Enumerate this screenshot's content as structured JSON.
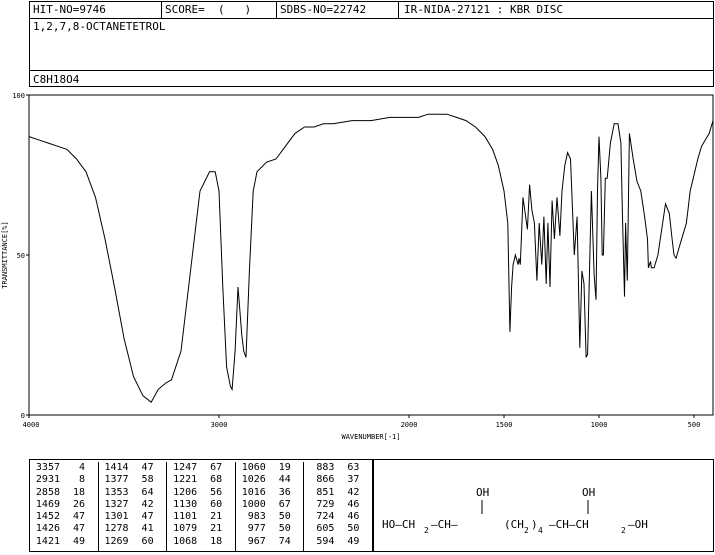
{
  "header": {
    "hit_no": "HIT-NO=9746",
    "score": "SCORE=  (   )",
    "sdbs_no": "SDBS-NO=22742",
    "ir_info": "IR-NIDA-27121 : KBR DISC",
    "compound": "1,2,7,8-OCTANETETROL",
    "formula": "C8H18O4"
  },
  "chart_data": {
    "type": "line",
    "xlabel": "WAVENUMBER[-1]",
    "ylabel": "TRANSMITTANCE[%]",
    "xlim": [
      4000,
      400
    ],
    "ylim": [
      0,
      100
    ],
    "x_ticks": [
      4000,
      3000,
      2000,
      1500,
      1000,
      500
    ],
    "y_ticks": [
      0,
      50,
      100
    ],
    "x": [
      4000,
      3950,
      3900,
      3850,
      3800,
      3750,
      3700,
      3650,
      3600,
      3550,
      3500,
      3450,
      3400,
      3357,
      3320,
      3280,
      3250,
      3200,
      3150,
      3100,
      3050,
      3020,
      3000,
      2980,
      2960,
      2940,
      2931,
      2915,
      2900,
      2880,
      2870,
      2858,
      2840,
      2820,
      2800,
      2750,
      2700,
      2650,
      2600,
      2550,
      2500,
      2450,
      2400,
      2300,
      2200,
      2100,
      2000,
      1950,
      1900,
      1850,
      1800,
      1750,
      1700,
      1650,
      1600,
      1560,
      1530,
      1500,
      1480,
      1469,
      1460,
      1452,
      1440,
      1426,
      1421,
      1414,
      1400,
      1377,
      1365,
      1353,
      1340,
      1327,
      1315,
      1301,
      1290,
      1278,
      1269,
      1258,
      1247,
      1235,
      1221,
      1206,
      1195,
      1180,
      1165,
      1150,
      1130,
      1115,
      1101,
      1090,
      1079,
      1068,
      1060,
      1050,
      1040,
      1026,
      1016,
      1008,
      1000,
      990,
      983,
      977,
      967,
      957,
      940,
      920,
      900,
      885,
      877,
      866,
      860,
      851,
      840,
      820,
      800,
      780,
      760,
      745,
      740,
      729,
      724,
      710,
      690,
      670,
      650,
      630,
      615,
      605,
      594,
      580,
      560,
      540,
      520,
      500,
      480,
      460,
      440,
      420,
      400
    ],
    "y": [
      87,
      86,
      85,
      84,
      83,
      80,
      76,
      68,
      55,
      40,
      24,
      12,
      6,
      4,
      8,
      10,
      11,
      20,
      45,
      70,
      76,
      76,
      70,
      40,
      15,
      9,
      8,
      20,
      40,
      25,
      20,
      18,
      45,
      70,
      76,
      79,
      80,
      84,
      88,
      90,
      90,
      91,
      91,
      92,
      92,
      93,
      93,
      93,
      94,
      94,
      94,
      93,
      92,
      90,
      87,
      83,
      78,
      70,
      60,
      26,
      40,
      47,
      50,
      47,
      49,
      47,
      68,
      58,
      72,
      64,
      60,
      42,
      60,
      47,
      62,
      41,
      60,
      40,
      67,
      55,
      68,
      56,
      70,
      78,
      82,
      80,
      50,
      62,
      21,
      45,
      41,
      18,
      19,
      45,
      70,
      44,
      36,
      70,
      87,
      74,
      50,
      50,
      74,
      74,
      85,
      91,
      91,
      85,
      63,
      37,
      60,
      42,
      88,
      80,
      73,
      70,
      62,
      55,
      46,
      48,
      46,
      46,
      50,
      58,
      66,
      63,
      55,
      50,
      49,
      52,
      56,
      60,
      70,
      75,
      80,
      84,
      86,
      88,
      92,
      85
    ]
  },
  "peaks": [
    [
      [
        "3357",
        "4"
      ],
      [
        "2931",
        "8"
      ],
      [
        "2858",
        "18"
      ],
      [
        "1469",
        "26"
      ],
      [
        "1452",
        "47"
      ],
      [
        "1426",
        "47"
      ],
      [
        "1421",
        "49"
      ]
    ],
    [
      [
        "1414",
        "47"
      ],
      [
        "1377",
        "58"
      ],
      [
        "1353",
        "64"
      ],
      [
        "1327",
        "42"
      ],
      [
        "1301",
        "47"
      ],
      [
        "1278",
        "41"
      ],
      [
        "1269",
        "60"
      ]
    ],
    [
      [
        "1247",
        "67"
      ],
      [
        "1221",
        "68"
      ],
      [
        "1206",
        "56"
      ],
      [
        "1130",
        "60"
      ],
      [
        "1101",
        "21"
      ],
      [
        "1079",
        "21"
      ],
      [
        "1068",
        "18"
      ]
    ],
    [
      [
        "1060",
        "19"
      ],
      [
        "1026",
        "44"
      ],
      [
        "1016",
        "36"
      ],
      [
        "1000",
        "67"
      ],
      [
        "983",
        "50"
      ],
      [
        "977",
        "50"
      ],
      [
        "967",
        "74"
      ]
    ],
    [
      [
        "883",
        "63"
      ],
      [
        "866",
        "37"
      ],
      [
        "851",
        "42"
      ],
      [
        "729",
        "46"
      ],
      [
        "724",
        "46"
      ],
      [
        "605",
        "50"
      ],
      [
        "594",
        "49"
      ]
    ]
  ],
  "structure": {
    "left_end": "HO—CH",
    "left_sub": "2",
    "ch1": "—CH—",
    "chain": "(CH",
    "chain_sub2": "2",
    "chain_close": ")",
    "chain_sub4": "4",
    "ch2": "—CH—CH",
    "right_sub": "2",
    "right_end": "—OH",
    "oh_top": "OH"
  }
}
